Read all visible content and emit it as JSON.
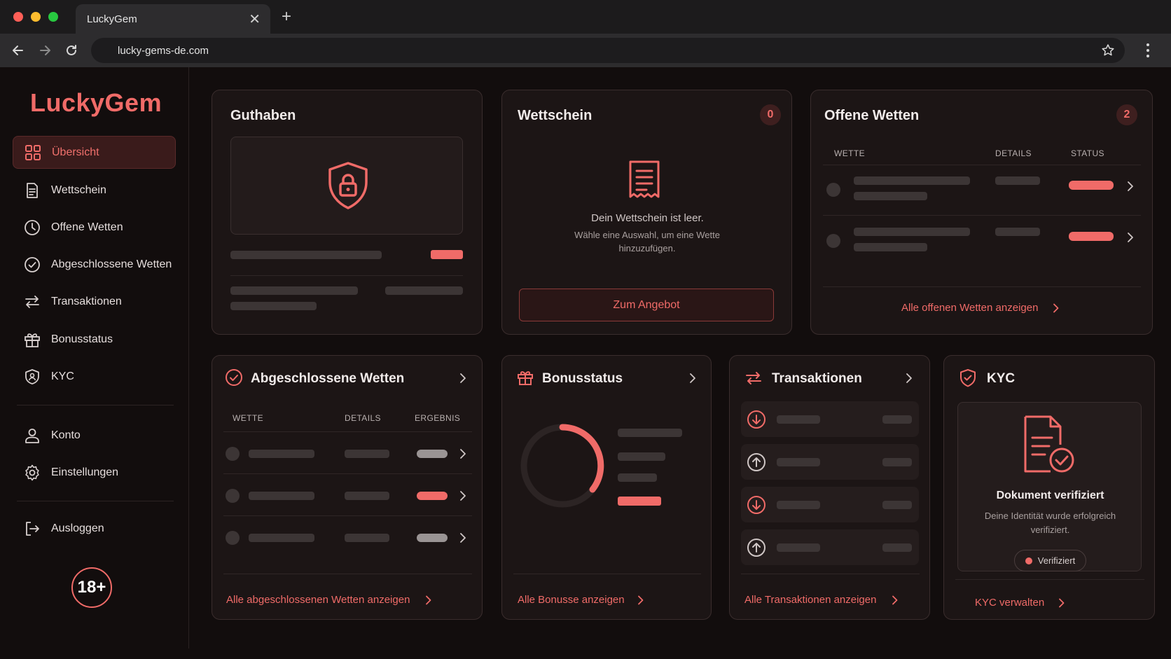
{
  "browser": {
    "tab_title": "LuckyGem",
    "url": "lucky-gems-de.com"
  },
  "sidebar": {
    "logo": "LuckyGem",
    "items": [
      {
        "label": "Übersicht",
        "icon": "grid-icon"
      },
      {
        "label": "Wettschein",
        "icon": "receipt-icon"
      },
      {
        "label": "Offene Wetten",
        "icon": "clock-icon"
      },
      {
        "label": "Abgeschlossene Wetten",
        "icon": "check-circle-icon"
      },
      {
        "label": "Transaktionen",
        "icon": "swap-icon"
      },
      {
        "label": "Bonusstatus",
        "icon": "gift-icon"
      },
      {
        "label": "KYC",
        "icon": "shield-user-icon"
      }
    ],
    "account_items": [
      {
        "label": "Konto",
        "icon": "user-icon"
      },
      {
        "label": "Einstellungen",
        "icon": "gear-icon"
      }
    ],
    "logout": "Ausloggen",
    "age_badge": "18+"
  },
  "guthaben": {
    "title": "Guthaben"
  },
  "wettschein": {
    "title": "Wettschein",
    "count": "0",
    "empty_title": "Dein Wettschein ist leer.",
    "empty_hint": "Wähle eine Auswahl, um eine Wette hinzuzufügen.",
    "button": "Zum Angebot"
  },
  "offene_wetten": {
    "title": "Offene Wetten",
    "count": "2",
    "columns": [
      "WETTE",
      "DETAILS",
      "STATUS"
    ],
    "link": "Alle offenen Wetten anzeigen"
  },
  "abgeschlossene": {
    "title": "Abgeschlossene Wetten",
    "columns": [
      "WETTE",
      "DETAILS",
      "ERGEBNIS"
    ],
    "link": "Alle abgeschlossenen Wetten anzeigen"
  },
  "bonus": {
    "title": "Bonusstatus",
    "link": "Alle Bonusse anzeigen"
  },
  "transaktionen": {
    "title": "Transaktionen",
    "link": "Alle Transaktionen anzeigen"
  },
  "kyc": {
    "title": "KYC",
    "doc_title": "Dokument verifiziert",
    "doc_text": "Deine Identität wurde erfolgreich verifiziert.",
    "badge": "Verifiziert",
    "link": "KYC verwalten"
  },
  "colors": {
    "accent": "#f06b68",
    "card_bg": "#1c1515",
    "page_bg": "#120d0d"
  }
}
